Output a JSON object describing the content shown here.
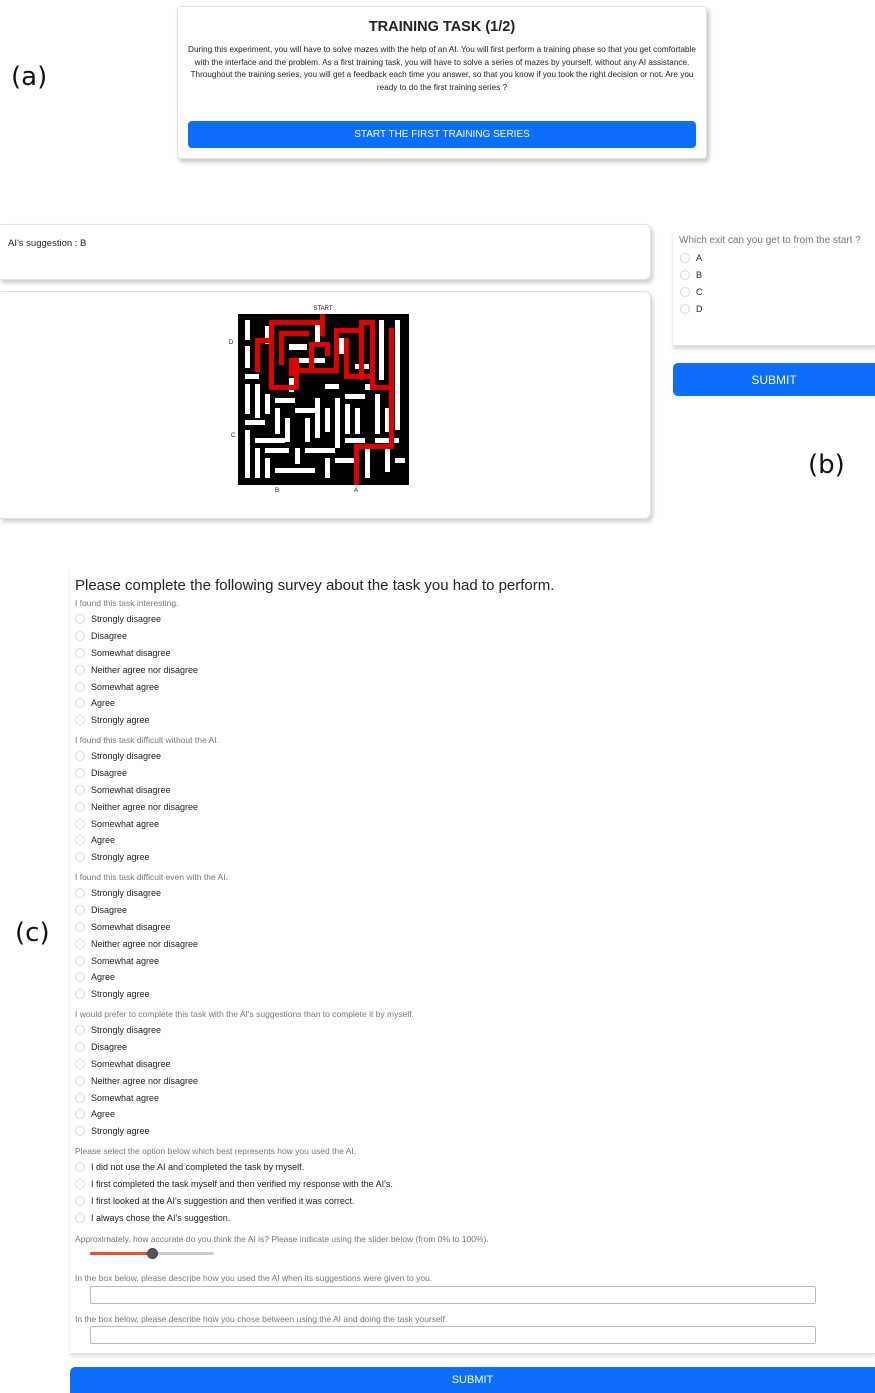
{
  "labels": {
    "a": "(a)",
    "b": "(b)",
    "c": "(c)"
  },
  "training": {
    "title": "TRAINING TASK (1/2)",
    "text": "During this experiment, you will have to solve mazes with the help of an AI. You will first perform a training phase so that you get comfortable with the interface and the problem. As a first training task, you will have to solve a series of mazes by yourself, without any AI assistance. Throughout the training series, you will get a feedback each time you answer, so that you know if you took the right decision or not. Are you ready to do the first training series ?",
    "button": "START THE FIRST TRAINING SERIES"
  },
  "task": {
    "suggestion": "AI's suggestion : B",
    "maze": {
      "start": "START",
      "exit_a": "A",
      "exit_b": "B",
      "exit_c": "C",
      "exit_d": "D",
      "path_color": "#e00000"
    },
    "question": "Which exit can you get to from the start ?",
    "options": [
      "A",
      "B",
      "C",
      "D"
    ],
    "submit": "SUBMIT"
  },
  "survey": {
    "title": "Please complete the following survey about the task you had to perform.",
    "likert_questions": [
      "I found this task interesting.",
      "I found this task difficult without the AI.",
      "I found this task difficult even with the AI.",
      "I would prefer to complete this task with the AI's suggestions than to complete it by myself."
    ],
    "likert_options": [
      "Strongly disagree",
      "Disagree",
      "Somewhat disagree",
      "Neither agree nor disagree",
      "Somewhat agree",
      "Agree",
      "Strongly agree"
    ],
    "usage_question": "Please select the option below which best represents how you used the AI.",
    "usage_options": [
      "I did not use the AI and completed the task by myself.",
      "I first completed the task myself and then verified my response with the AI's.",
      "I first looked at the AI's suggestion and then verified it was correct.",
      "I always chose the AI's suggestion."
    ],
    "accuracy_question": "Approximately, how accurate do you think the AI is? Please indicate using the slider below (from 0% to 100%).",
    "accuracy_value": 0.5,
    "slider_color": "#e8502a",
    "describe_use_question": "In the box below, please describe how you used the AI when its suggestions were given to you.",
    "describe_choice_question": "In the box below, please describe how you chose between using the AI and doing the task yourself.",
    "submit": "SUBMIT"
  }
}
